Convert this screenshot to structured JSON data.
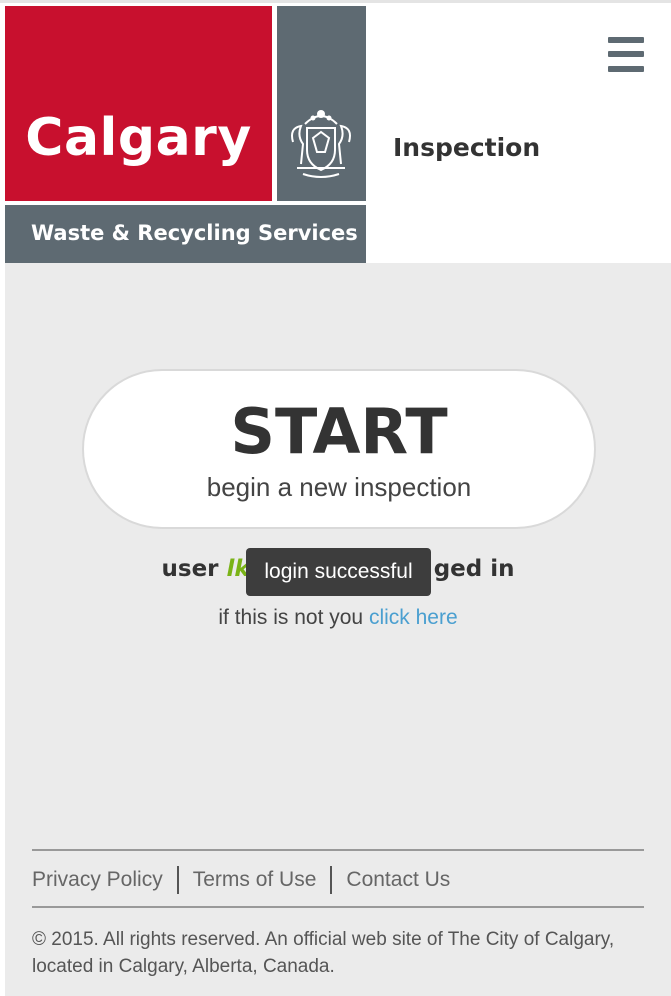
{
  "header": {
    "logo_word": "Calgary",
    "logo_subtitle": "Waste & Recycling Services",
    "page_title": "Inspection",
    "menu_icon": "hamburger-menu-icon"
  },
  "start": {
    "title": "START",
    "subtitle": "begin a new inspection"
  },
  "status": {
    "prefix": "user ",
    "username": "lk",
    "suffix": "ged in",
    "not_you_text": "if this is not you ",
    "click_here": "click here"
  },
  "toast": {
    "message": "login successful"
  },
  "footer": {
    "links": [
      "Privacy Policy",
      "Terms of Use",
      "Contact Us"
    ],
    "copyright": "© 2015. All rights reserved. An official web site of The City of Calgary, located in Calgary, Alberta, Canada."
  },
  "colors": {
    "brand_red": "#c8102e",
    "brand_slate": "#5e6a72",
    "username_green": "#7ab317",
    "link_blue": "#4a9fd0"
  }
}
